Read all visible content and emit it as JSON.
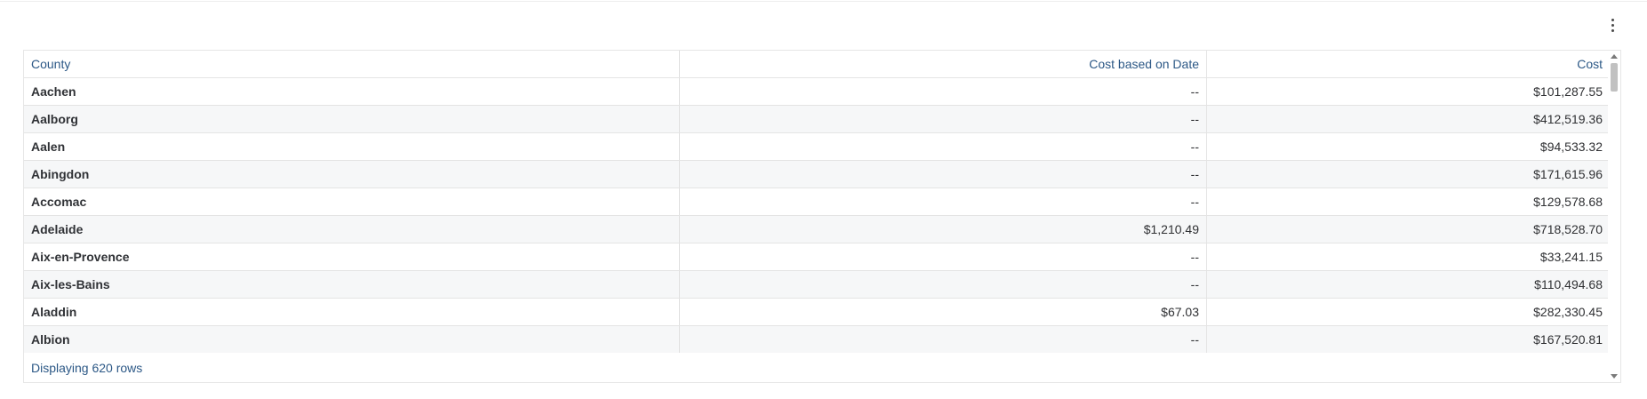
{
  "table": {
    "columns": [
      "County",
      "Cost based on Date",
      "Cost"
    ],
    "rows": [
      [
        "Aachen",
        "--",
        "$101,287.55"
      ],
      [
        "Aalborg",
        "--",
        "$412,519.36"
      ],
      [
        "Aalen",
        "--",
        "$94,533.32"
      ],
      [
        "Abingdon",
        "--",
        "$171,615.96"
      ],
      [
        "Accomac",
        "--",
        "$129,578.68"
      ],
      [
        "Adelaide",
        "$1,210.49",
        "$718,528.70"
      ],
      [
        "Aix-en-Provence",
        "--",
        "$33,241.15"
      ],
      [
        "Aix-les-Bains",
        "--",
        "$110,494.68"
      ],
      [
        "Aladdin",
        "$67.03",
        "$282,330.45"
      ],
      [
        "Albion",
        "--",
        "$167,520.81"
      ]
    ],
    "footer": "Displaying 620 rows"
  },
  "icons": {
    "menu": "more-vertical-icon",
    "scroll_up": "arrow-up-icon",
    "scroll_down": "arrow-down-icon"
  }
}
